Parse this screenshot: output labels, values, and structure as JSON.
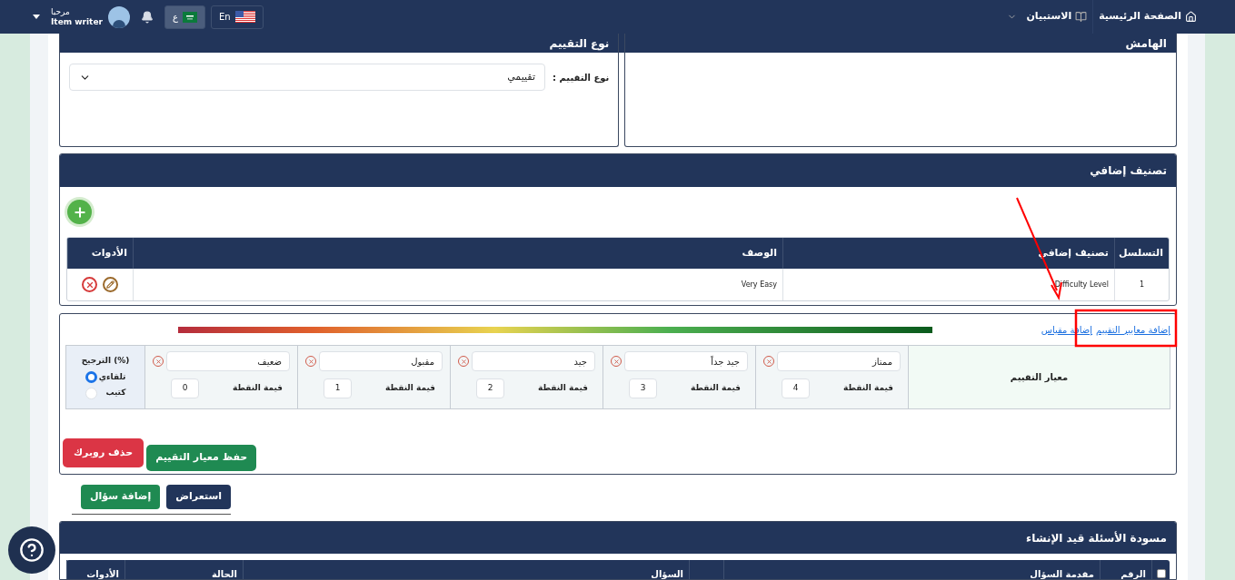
{
  "header": {
    "nav": [
      {
        "label": "الصفحة الرئيسية",
        "kind": "home"
      },
      {
        "label": "الاستبيان",
        "kind": "survey"
      }
    ],
    "languages": [
      {
        "label": "En",
        "kind": "en",
        "selected": false
      },
      {
        "label": "ع",
        "kind": "ar",
        "selected": true
      }
    ],
    "user": {
      "greeting": "مرحبا",
      "role": "Item writer"
    }
  },
  "margin_panel": {
    "title": "الهامش"
  },
  "assessment_type": {
    "title": "نوع التقييم",
    "label": "نوع التقييم :",
    "value": "تقييمي"
  },
  "extra_classification": {
    "title": "تصنيف إضافي",
    "columns": [
      "التسلسل",
      "تصنيف إضافي",
      "الوصف",
      "الأدوات"
    ],
    "rows": [
      {
        "cells": [
          "1",
          "Difficulty Level",
          "Very Easy"
        ]
      }
    ]
  },
  "rubric": {
    "links": [
      "إضافة معايير التقييم",
      "إضافة مقياس"
    ],
    "criterion_label": "معيار التقييم",
    "levels": [
      {
        "name": "ممتاز",
        "point_label": "قيمة النقطة",
        "points": "4"
      },
      {
        "name": "جيد جداً",
        "point_label": "قيمة النقطة",
        "points": "3"
      },
      {
        "name": "جيد",
        "point_label": "قيمة النقطة",
        "points": "2"
      },
      {
        "name": "مقبول",
        "point_label": "قيمة النقطة",
        "points": "1"
      },
      {
        "name": "ضعيف",
        "point_label": "قيمة النقطة",
        "points": "0"
      }
    ],
    "weighting": {
      "title": "(%) الترجيح",
      "options": [
        {
          "label": "تلقاءي",
          "selected": true
        },
        {
          "label": "كتيب",
          "selected": false
        }
      ]
    },
    "buttons": [
      {
        "label": "حفظ معيار التقييم",
        "kind": "save"
      },
      {
        "label": "حذف روبرك",
        "kind": "delete"
      }
    ]
  },
  "actions": [
    {
      "label": "استعراض",
      "kind": "preview"
    },
    {
      "label": "إضافة سؤال",
      "kind": "add"
    }
  ],
  "drafts": {
    "title": "مسودة الأسئلة قيد الإنشاء",
    "select_all": {
      "checked": false
    },
    "columns": [
      "الرقم",
      "مقدمة السؤال",
      "السؤال",
      "الحالة",
      "الأدوات"
    ]
  }
}
